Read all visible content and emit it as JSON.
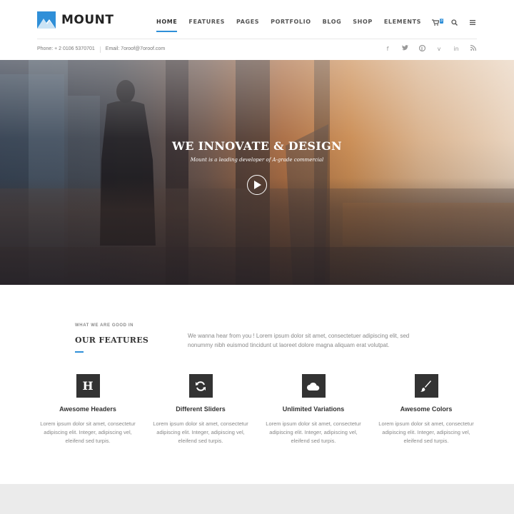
{
  "brand": {
    "name": "MOUNT",
    "accent": "#2f8fd8"
  },
  "nav": {
    "items": [
      {
        "label": "HOME",
        "active": true
      },
      {
        "label": "FEATURES"
      },
      {
        "label": "PAGES"
      },
      {
        "label": "PORTFOLIO"
      },
      {
        "label": "BLOG"
      },
      {
        "label": "SHOP"
      },
      {
        "label": "ELEMENTS"
      }
    ],
    "cart_count": "3",
    "icons": [
      "cart-icon",
      "search-icon",
      "menu-icon"
    ]
  },
  "topbar": {
    "phone": "Phone: + 2 0106 5370701",
    "email": "Email: 7oroof@7oroof.com",
    "socials": [
      "facebook-icon",
      "twitter-icon",
      "pinterest-icon",
      "vimeo-icon",
      "linkedin-icon",
      "rss-icon"
    ]
  },
  "hero": {
    "title": "WE INNOVATE & DESIGN",
    "subtitle": "Mount is a leading developer of A-grade commercial"
  },
  "features": {
    "kicker": "WHAT WE ARE GOOD IN",
    "title": "OUR FEATURES",
    "intro": "We wanna hear from you ! Lorem ipsum dolor sit amet, consectetuer adipiscing elit, sed nonummy nibh euismod tincidunt ut laoreet dolore magna aliquam erat volutpat.",
    "items": [
      {
        "icon": "heading-icon",
        "title": "Awesome Headers",
        "text": "Lorem ipsum dolor sit amet, consectetur adipiscing elit. Integer, adipiscing vel, eleifend sed turpis."
      },
      {
        "icon": "refresh-icon",
        "title": "Different Sliders",
        "text": "Lorem ipsum dolor sit amet, consectetur adipiscing elit. Integer, adipiscing vel, eleifend sed turpis."
      },
      {
        "icon": "cloud-icon",
        "title": "Unlimited Variations",
        "text": "Lorem ipsum dolor sit amet, consectetur adipiscing elit. Integer, adipiscing vel, eleifend sed turpis."
      },
      {
        "icon": "brush-icon",
        "title": "Awesome Colors",
        "text": "Lorem ipsum dolor sit amet, consectetur adipiscing elit. Integer, adipiscing vel, eleifend sed turpis."
      }
    ]
  }
}
